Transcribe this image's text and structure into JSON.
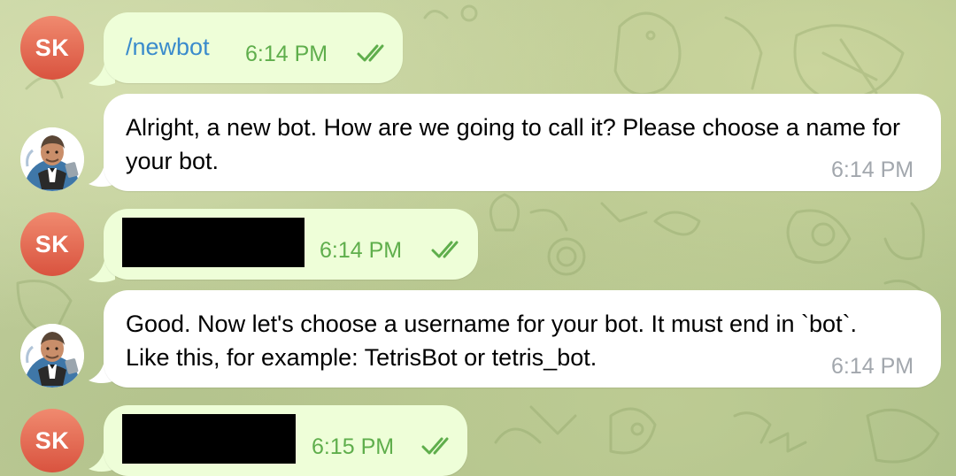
{
  "colors": {
    "outgoing_bubble": "#eefed8",
    "incoming_bubble": "#ffffff",
    "avatar_user": "#e06a52",
    "link": "#3a8bcc",
    "time_outgoing": "#5fae4c",
    "time_incoming": "#a2a7ad",
    "redaction": "#000000"
  },
  "messages": [
    {
      "sender": "user",
      "avatar_initials": "SK",
      "text": "/newbot",
      "time": "6:14 PM",
      "status_icon": "double-check-icon"
    },
    {
      "sender": "bot",
      "avatar_icon": "bot-avatar-icon",
      "text": "Alright, a new bot. How are we going to call it? Please choose a name for your bot.",
      "time": "6:14 PM"
    },
    {
      "sender": "user",
      "avatar_initials": "SK",
      "text_redacted": true,
      "time": "6:14 PM",
      "status_icon": "double-check-icon"
    },
    {
      "sender": "bot",
      "avatar_icon": "bot-avatar-icon",
      "text": "Good. Now let's choose a username for your bot. It must end in `bot`. Like this, for example: TetrisBot or tetris_bot.",
      "time": "6:14 PM"
    },
    {
      "sender": "user",
      "avatar_initials": "SK",
      "text_redacted": true,
      "time": "6:15 PM",
      "status_icon": "double-check-icon"
    }
  ]
}
